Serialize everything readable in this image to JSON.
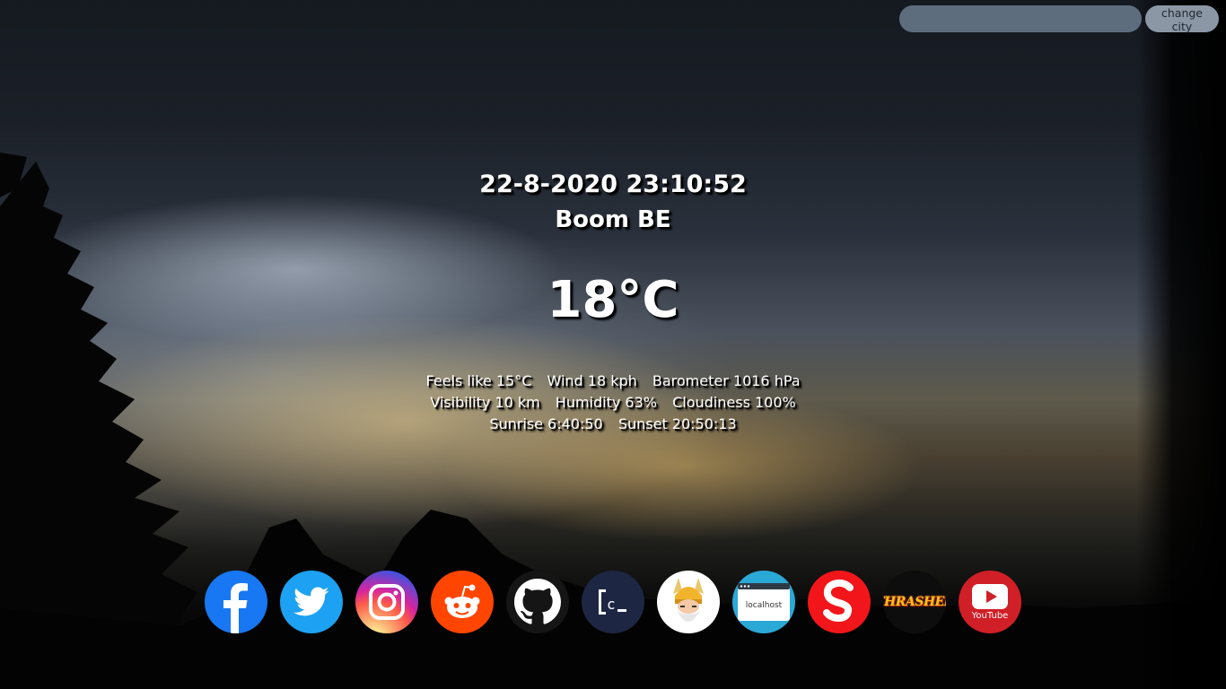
{
  "search": {
    "value": "",
    "placeholder": "",
    "button_label": "change city"
  },
  "weather": {
    "datetime": "22-8-2020 23:10:52",
    "city": "Boom BE",
    "temperature": "18°C",
    "feels_like": "Feels like 15°C",
    "wind": "Wind 18 kph",
    "barometer": "Barometer 1016 hPa",
    "visibility": "Visibility 10 km",
    "humidity": "Humidity 63%",
    "cloudiness": "Cloudiness 100%",
    "sunrise": "Sunrise 6:40:50",
    "sunset": "Sunset 20:50:13"
  },
  "shortcuts": {
    "localhost_label": "localhost",
    "thrasher_label": "THRASHER",
    "youtube_label": "YouTube",
    "items": [
      {
        "icon": "facebook-icon",
        "color": "#1877f2"
      },
      {
        "icon": "twitter-icon",
        "color": "#1da1f2"
      },
      {
        "icon": "instagram-icon",
        "color": "#d6249f"
      },
      {
        "icon": "reddit-icon",
        "color": "#ff4500"
      },
      {
        "icon": "github-icon",
        "color": "#151515"
      },
      {
        "icon": "codeanywhere-icon",
        "color": "#1d2743"
      },
      {
        "icon": "odin-icon",
        "color": "#ffffff"
      },
      {
        "icon": "localhost-icon",
        "color": "#2aa8d6"
      },
      {
        "icon": "s-app-icon",
        "color": "#f2161a"
      },
      {
        "icon": "thrasher-icon",
        "color": "#0d0d0d"
      },
      {
        "icon": "youtube-icon",
        "color": "#d01f27"
      }
    ]
  }
}
